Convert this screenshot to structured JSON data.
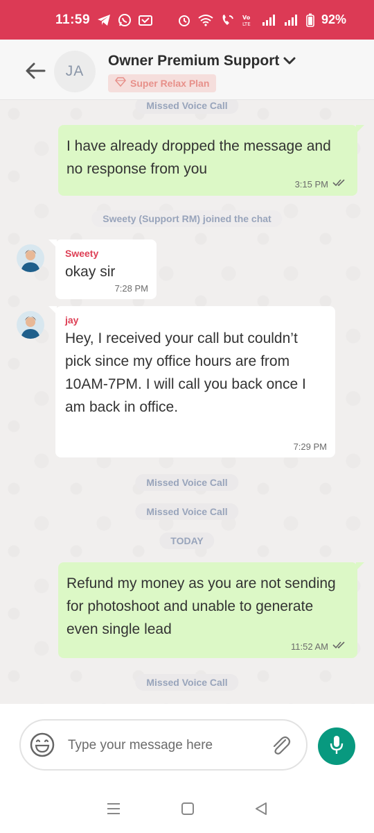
{
  "status_bar": {
    "time": "11:59",
    "battery": "92%"
  },
  "header": {
    "avatar_initials": "JA",
    "title": "Owner Premium Support",
    "plan": "Super Relax Plan"
  },
  "messages": {
    "sys_missed_top": "Missed Voice Call",
    "out1": {
      "text": "I have already dropped the message and no response from you",
      "time": "3:15 PM"
    },
    "sys_joined": "Sweety (Support RM) joined the chat",
    "in1": {
      "sender": "Sweety",
      "text": "okay sir",
      "time": "7:28 PM"
    },
    "in2": {
      "sender": "jay",
      "text": "Hey, I received your call but couldn’t pick since my office hours are from 10AM-7PM. I will call you back once I am back in office.",
      "time": "7:29 PM"
    },
    "sys_missed_2": "Missed Voice Call",
    "sys_missed_3": "Missed Voice Call",
    "date_divider": "TODAY",
    "out2": {
      "text": "Refund my money as you are not sending for photoshoot and unable to generate even single lead",
      "time": "11:52 AM"
    },
    "sys_missed_4": "Missed Voice Call"
  },
  "composer": {
    "placeholder": "Type your message here"
  },
  "colors": {
    "status_bar": "#dc3a55",
    "outgoing_bubble": "#dcf8c6",
    "mic_button": "#08997f",
    "sender_name": "#dd3f55"
  }
}
